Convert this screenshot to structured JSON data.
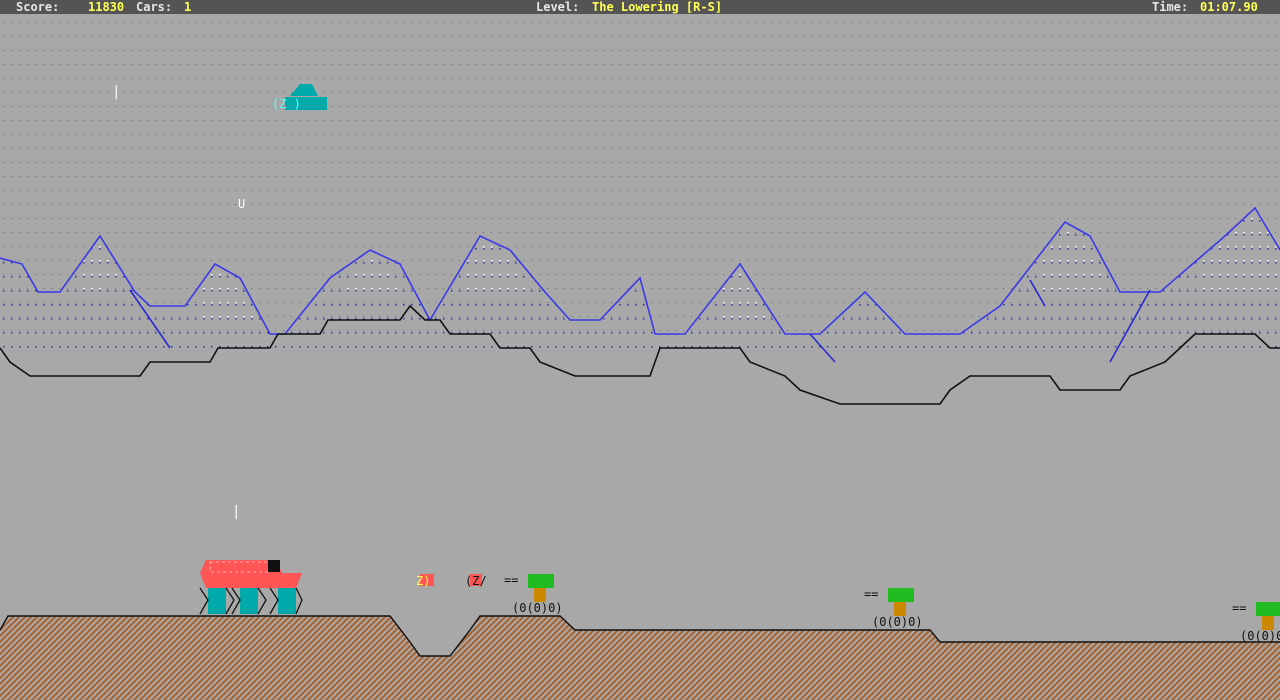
{
  "hud": {
    "score_label": "Score:",
    "score_value": "11830",
    "cars_label": "Cars:",
    "cars_value": "1",
    "level_label": "Level:",
    "level_value": "The Lowering [R-S]",
    "time_label": "Time:",
    "time_value": "01:07.90"
  },
  "sprites": {
    "ufo_top": "/Z/\\",
    "ufo_bottom": "(Z      )",
    "bullet_up": "|",
    "bomb": "U",
    "mine_a": "Z)",
    "mine_b": "(Z/",
    "turret_gun": "==",
    "turret_body": "Z",
    "turret_wheels": "(0(0)0)"
  },
  "colors": {
    "sky_dots": "#0a8f8a",
    "mountain_line": "#3a3ae8",
    "ground": "#a86432",
    "buggy_red": "#ff5555",
    "buggy_cyan": "#00aaaa",
    "turret_green": "#22bb22",
    "hud_yellow": "#ffff55"
  }
}
